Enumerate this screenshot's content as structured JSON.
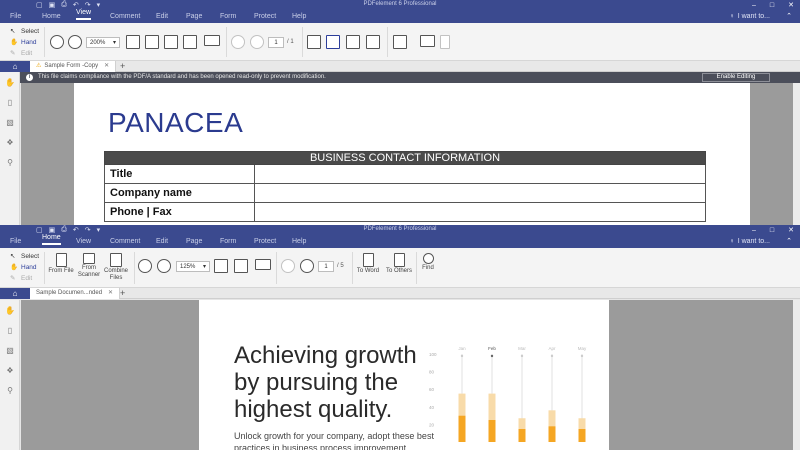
{
  "windows": [
    {
      "app_title": "PDFelement 6 Professional",
      "menu": [
        "File",
        "Home",
        "View",
        "Comment",
        "Edit",
        "Page",
        "Form",
        "Protect",
        "Help"
      ],
      "active_menu": "View",
      "search_hint": "I want to...",
      "modes": [
        "Select",
        "Hand",
        "Edit"
      ],
      "active_mode": "Hand",
      "zoom": "200%",
      "current_page": "1",
      "page_total": "/ 1",
      "tab_title": "Sample Form -Copy",
      "notice": "This file claims compliance with the PDF/A standard and has been opened read-only to prevent modification.",
      "enable_editing": "Enable Editing",
      "document": {
        "brand": "PANACEA",
        "table_header": "BUSINESS CONTACT INFORMATION",
        "rows": [
          "Title",
          "Company name",
          "Phone | Fax"
        ]
      }
    },
    {
      "app_title": "PDFelement 6 Professional",
      "menu": [
        "File",
        "Home",
        "View",
        "Comment",
        "Edit",
        "Page",
        "Form",
        "Protect",
        "Help"
      ],
      "active_menu": "Home",
      "search_hint": "I want to...",
      "modes": [
        "Select",
        "Hand",
        "Edit"
      ],
      "active_mode": "Hand",
      "zoom": "125%",
      "current_page": "1",
      "page_total": "/ 5",
      "tools": {
        "from_file": "From File",
        "from_scanner": [
          "From",
          "Scanner"
        ],
        "combine_files": [
          "Combine",
          "Files"
        ],
        "to_word": "To Word",
        "to_others": "To Others",
        "find": "Find"
      },
      "tab_title": "Sample Documen...nded",
      "document": {
        "heading": [
          "Achieving growth",
          "by pursuing the",
          "highest quality."
        ],
        "body": [
          "Unlock growth for your company, adopt these best",
          "practices in business process improvement"
        ],
        "chart_data": {
          "type": "bar",
          "categories": [
            "Jan",
            "Feb",
            "Mar",
            "Apr",
            "May"
          ],
          "ylim": [
            0,
            100
          ],
          "y_ticks": [
            100,
            80,
            60,
            40,
            20
          ],
          "series": [
            {
              "values": [
                30,
                25,
                15,
                18,
                15
              ],
              "color": "#f5a623"
            },
            {
              "values": [
                25,
                30,
                12,
                18,
                12
              ],
              "color": "#f8dba9"
            }
          ],
          "grid": false,
          "highlighted_category": "Feb"
        }
      }
    }
  ],
  "colors": {
    "chrome": "#3b4a8f",
    "accent": "#2d3e9a",
    "brand": "#2b3b8f",
    "notice_bg": "#4b4e5a"
  }
}
